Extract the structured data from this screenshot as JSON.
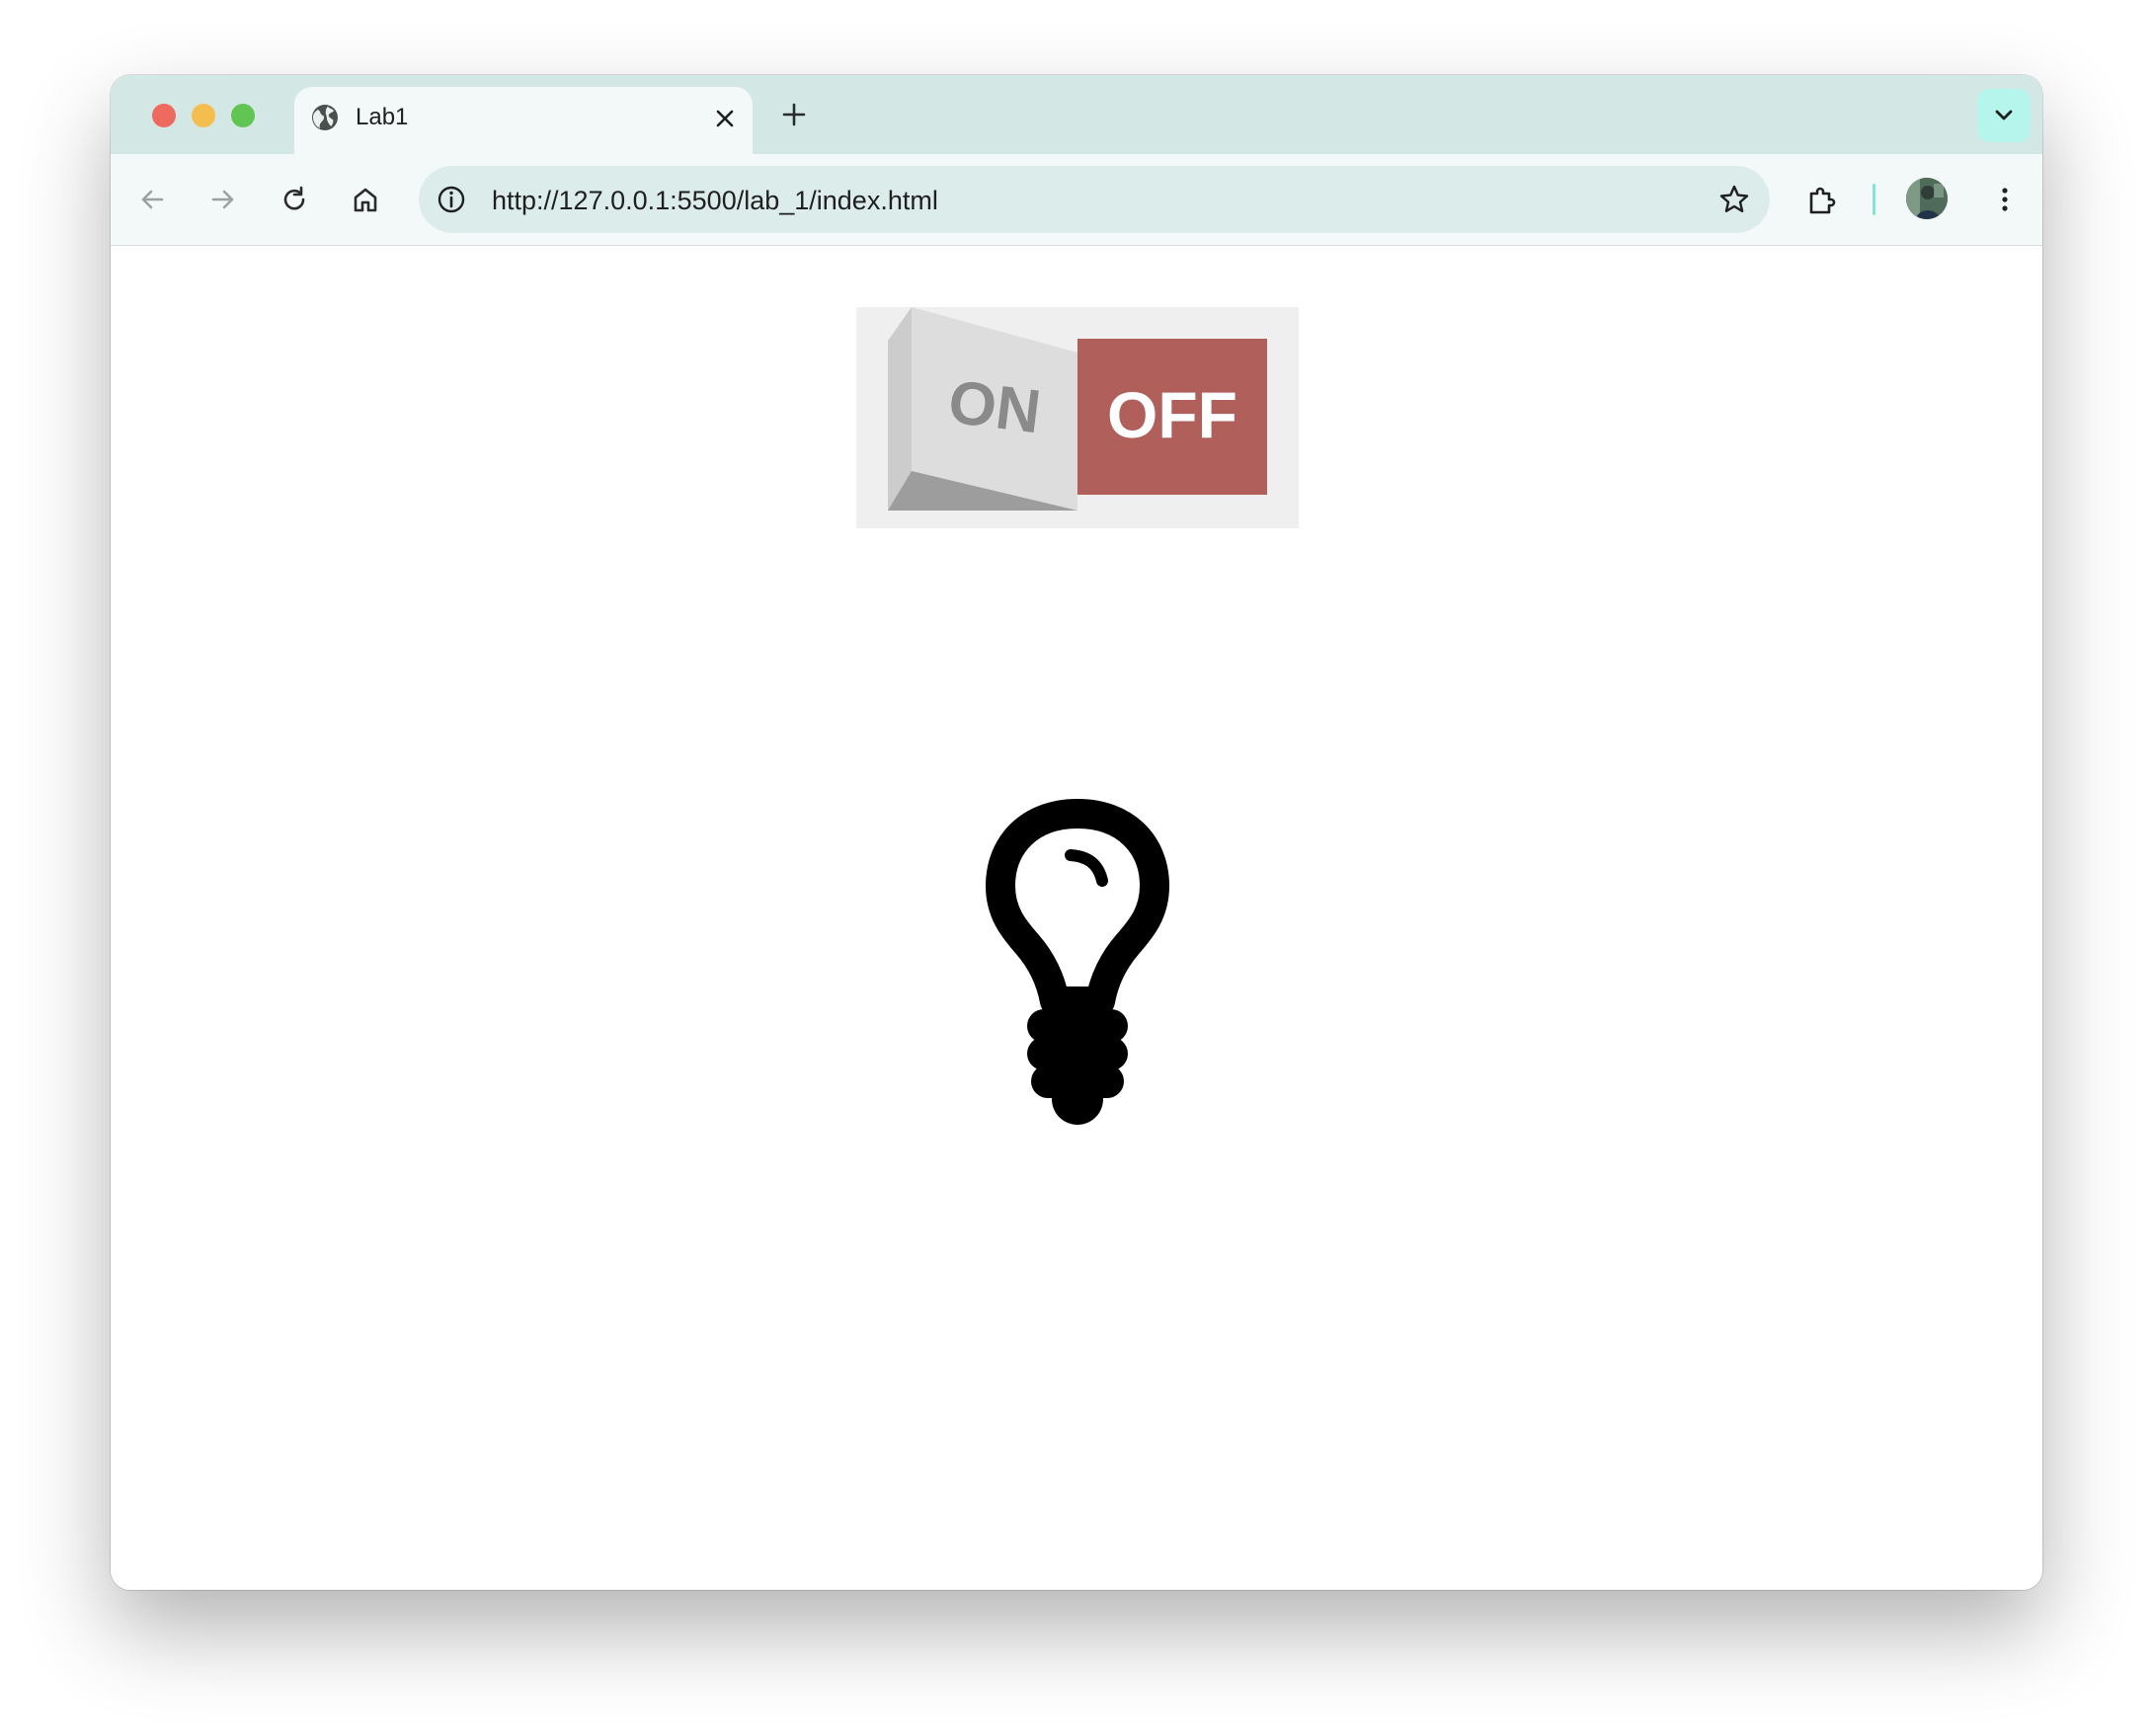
{
  "browser": {
    "tab": {
      "title": "Lab1",
      "favicon": "globe-icon"
    },
    "address_bar": {
      "url": "http://127.0.0.1:5500/lab_1/index.html"
    },
    "accent_color": "#d3e8e5",
    "toolbar_color": "#f3f9f8"
  },
  "page": {
    "switch": {
      "on_label": "ON",
      "off_label": "OFF",
      "state": "off",
      "off_color": "#b05f5b"
    },
    "bulb": {
      "state": "off",
      "icon": "lightbulb-icon",
      "color": "#000000"
    }
  }
}
